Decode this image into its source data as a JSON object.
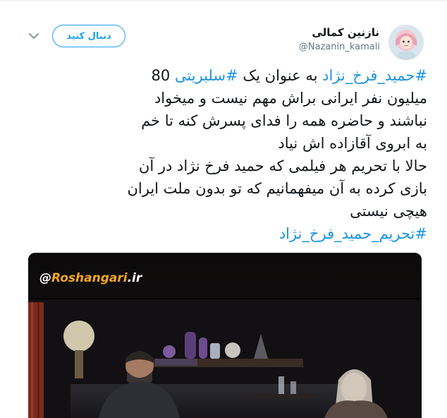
{
  "user": {
    "display_name": "نازنین کمالی",
    "handle": "@Nazanin_kamali",
    "avatar_icon": "avatar-illustration"
  },
  "follow_button": {
    "label": "دنبال کنید"
  },
  "caret_icon": "chevron-down-icon",
  "tweet": {
    "lines": [
      {
        "hashtag_a": "#حمید_فرخ_نژاد",
        "text_a": " به عنوان یک ",
        "hashtag_b": "#سلبریتی",
        "text_b": " 80"
      },
      {
        "text": "میلیون نفر ایرانی براش مهم نیست و میخواد"
      },
      {
        "text": "نباشند و حاضره همه را فدای پسرش کنه تا خم"
      },
      {
        "text": "به ابروی آقازاده اش نیاد"
      },
      {
        "text": "حالا با تحریم هر فیلمی که حمید فرخ نژاد در آن"
      },
      {
        "text": "بازی کرده به آن میفهمانیم که تو بدون ملت ایران"
      },
      {
        "text": "هیچی نیستی"
      },
      {
        "hashtag": "#تحریم_حمید_فرخ_نژاد"
      }
    ]
  },
  "media": {
    "watermark_at": "@",
    "watermark_name": "Roshangari",
    "watermark_suffix": ".ir"
  },
  "colors": {
    "link": "#1b95e0",
    "follow": "#1da1f2",
    "text": "#14171a",
    "muted": "#657786"
  }
}
